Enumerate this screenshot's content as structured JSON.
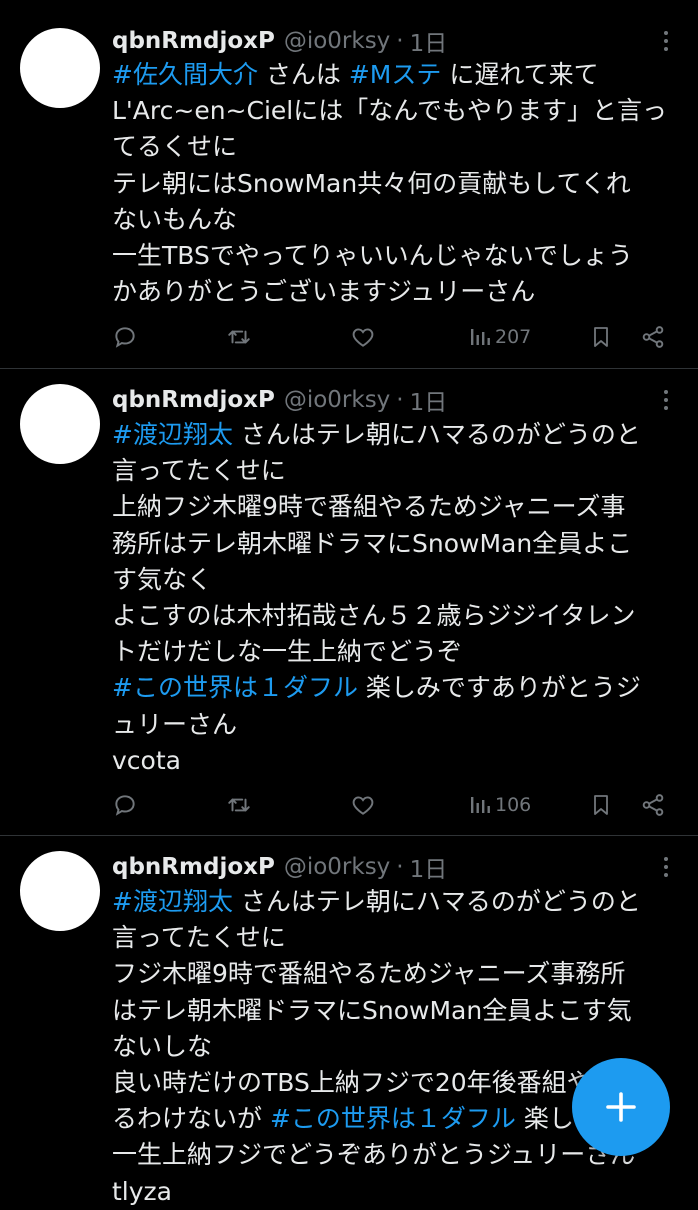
{
  "tweets": [
    {
      "author_name": "qbnRmdjoxP",
      "author_handle": "@io0rksy",
      "dot": "·",
      "time": "1日",
      "lines": [
        [
          {
            "t": "#佐久間大介",
            "tag": true
          },
          {
            "t": " さんは "
          },
          {
            "t": "#Mステ",
            "tag": true
          },
          {
            "t": " に遅れて来て"
          }
        ],
        [
          {
            "t": "L'Arc~en~Cielには「なんでもやります」と言っ"
          }
        ],
        [
          {
            "t": "てるくせに"
          }
        ],
        [
          {
            "t": "テレ朝にはSnowMan共々何の貢献もしてくれ"
          }
        ],
        [
          {
            "t": "ないもんな"
          }
        ],
        [
          {
            "t": "一生TBSでやってりゃいいんじゃないでしょう"
          }
        ],
        [
          {
            "t": "かありがとうございますジュリーさん"
          }
        ]
      ],
      "views": "207"
    },
    {
      "author_name": "qbnRmdjoxP",
      "author_handle": "@io0rksy",
      "dot": "·",
      "time": "1日",
      "lines": [
        [
          {
            "t": "#渡辺翔太",
            "tag": true
          },
          {
            "t": " さんはテレ朝にハマるのがどうのと"
          }
        ],
        [
          {
            "t": "言ってたくせに"
          }
        ],
        [
          {
            "t": "上納フジ木曜9時で番組やるためジャニーズ事"
          }
        ],
        [
          {
            "t": "務所はテレ朝木曜ドラマにSnowMan全員よこ"
          }
        ],
        [
          {
            "t": "す気なく"
          }
        ],
        [
          {
            "t": "よこすのは木村拓哉さん５２歳らジジイタレン"
          }
        ],
        [
          {
            "t": "トだけだしな一生上納でどうぞ"
          }
        ],
        [
          {
            "t": "#この世界は１ダフル",
            "tag": true
          },
          {
            "t": " 楽しみですありがとうジ"
          }
        ],
        [
          {
            "t": "ュリーさん"
          }
        ],
        [
          {
            "t": "vcota"
          }
        ]
      ],
      "views": "106"
    },
    {
      "author_name": "qbnRmdjoxP",
      "author_handle": "@io0rksy",
      "dot": "·",
      "time": "1日",
      "lines": [
        [
          {
            "t": "#渡辺翔太",
            "tag": true
          },
          {
            "t": " さんはテレ朝にハマるのがどうのと"
          }
        ],
        [
          {
            "t": "言ってたくせに"
          }
        ],
        [
          {
            "t": "フジ木曜9時で番組やるためジャニーズ事務所"
          }
        ],
        [
          {
            "t": "はテレ朝木曜ドラマにSnowMan全員よこす気"
          }
        ],
        [
          {
            "t": "ないしな"
          }
        ],
        [
          {
            "t": "良い時だけのTBS上納フジで20年後番組やって"
          }
        ],
        [
          {
            "t": "るわけないが "
          },
          {
            "t": "#この世界は１ダフル",
            "tag": true
          },
          {
            "t": " 楽しみです"
          }
        ],
        [
          {
            "t": "一生上納フジでどうぞありがとうジュリーさん"
          }
        ],
        [
          {
            "t": "tlyza"
          }
        ]
      ],
      "views": ""
    }
  ],
  "icons": {
    "reply": "reply-icon",
    "retweet": "retweet-icon",
    "like": "like-icon",
    "views": "views-icon",
    "bookmark": "bookmark-icon",
    "share": "share-icon",
    "more": "more-icon",
    "compose": "compose-plus-icon"
  },
  "colors": {
    "background": "#000000",
    "text": "#e7e9ea",
    "muted": "#71767b",
    "accent": "#1d9bf0",
    "divider": "#2f3336"
  }
}
